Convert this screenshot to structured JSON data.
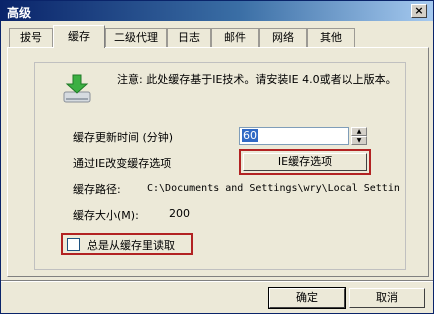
{
  "window": {
    "title": "高级",
    "close_label": "×"
  },
  "tabs": [
    {
      "label": "拔号"
    },
    {
      "label": "缓存"
    },
    {
      "label": "二级代理"
    },
    {
      "label": "日志"
    },
    {
      "label": "邮件"
    },
    {
      "label": "网络"
    },
    {
      "label": "其他"
    }
  ],
  "tab_scroll_label": "▶",
  "cache": {
    "note": "注意: 此处缓存基于IE技术。请安装IE 4.0或者以上版本。",
    "update_interval_label": "缓存更新时间 (分钟)",
    "update_interval_value": "60",
    "ie_options_prompt": "通过IE改变缓存选项",
    "ie_options_button": "IE缓存选项",
    "path_label": "缓存路径:",
    "path_value": "C:\\Documents and Settings\\wry\\Local Settin",
    "size_label": "缓存大小(M):",
    "size_value": "200",
    "always_read_label": "总是从缓存里读取"
  },
  "buttons": {
    "ok": "确定",
    "cancel": "取消"
  },
  "colors": {
    "highlight": "#b22222",
    "title_bar": "#0a246a",
    "selection": "#316ac5"
  },
  "icons": {
    "note": "download-cache-icon"
  }
}
